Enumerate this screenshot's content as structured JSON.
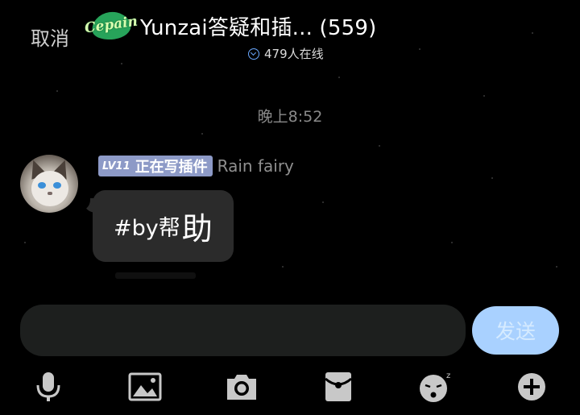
{
  "header": {
    "cancel_label": "取消",
    "logo_text": "Cepain",
    "group_title": "Yunzai答疑和插... (559)",
    "online_text": "479人在线"
  },
  "chat": {
    "timestamp": "晚上8:52",
    "messages": [
      {
        "level": "LV11",
        "title": "正在写插件",
        "sender": "Rain fairy",
        "text_small": "#by帮",
        "text_big": "助"
      }
    ]
  },
  "composer": {
    "input_value": "",
    "input_placeholder": "",
    "send_label": "发送"
  },
  "toolbar": {
    "icons": [
      "microphone-icon",
      "image-icon",
      "camera-icon",
      "red-packet-icon",
      "emoji-icon",
      "plus-icon"
    ]
  },
  "colors": {
    "background": "#000000",
    "bubble": "#2b2b2b",
    "badge": "#8d9ac7",
    "send_button": "#a9d1ff",
    "icon": "#c8c8c8"
  }
}
